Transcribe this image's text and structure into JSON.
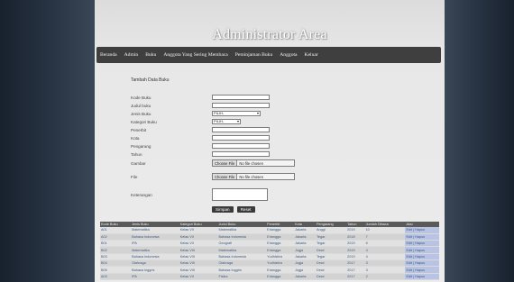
{
  "header": {
    "title": "Administrator Area"
  },
  "nav": [
    "Beranda",
    "Admin",
    "Buku",
    "Anggota Yang Sering Membaca",
    "Peminjaman Buku",
    "Anggota",
    "Keluar"
  ],
  "form": {
    "title": "Tambah Data Buku",
    "fields": {
      "kode": {
        "label": "Kode Buku"
      },
      "judul": {
        "label": "Judul buku"
      },
      "jenis": {
        "label": "Jenis Buku",
        "value": "PILIH-"
      },
      "kategori": {
        "label": "Kategori Buku",
        "value": "PILIH-"
      },
      "penerbit": {
        "label": "Penerbit"
      },
      "kota": {
        "label": "Kota"
      },
      "pengarang": {
        "label": "Pengarang"
      },
      "tahun": {
        "label": "Tahun"
      },
      "gambar": {
        "label": "Gambar",
        "button": "Choose File",
        "status": "No file chosen"
      },
      "file": {
        "label": "File",
        "button": "Choose File",
        "status": "No file chosen"
      },
      "keterangan": {
        "label": "Keterangan"
      }
    },
    "save_label": "Simpan",
    "reset_label": "Reset"
  },
  "table": {
    "headers": [
      "Kode Buku",
      "Jenis Buku",
      "Kategori Buku",
      "Judul Buku",
      "Penerbit",
      "Kota",
      "Pengarang",
      "Tahun",
      "Jumlah Dibaca",
      "Aksi"
    ],
    "rows": [
      [
        "A01",
        "Matematika",
        "Kelas VII",
        "Matematika",
        "Erlangga",
        "Jakarta",
        "Anggi",
        "2019",
        "10",
        "Edit | Hapus"
      ],
      [
        "A02",
        "Bahasa Indonesia",
        "Kelas VII",
        "Bahasa Indonesia",
        "Erlangga",
        "Jakarta",
        "Tegar",
        "2018",
        "7",
        "Edit | Hapus"
      ],
      [
        "B01",
        "IPA",
        "Kelas VII",
        "Geografi",
        "Erlangga",
        "Jakarta",
        "Tegar",
        "2019",
        "6",
        "Edit | Hapus"
      ],
      [
        "B02",
        "Matematika",
        "Kelas VIII",
        "Matematika",
        "Erlangga",
        "Jogja",
        "Dewi",
        "2019",
        "4",
        "Edit | Hapus"
      ],
      [
        "B03",
        "Bahasa Indonesia",
        "Kelas VIII",
        "Bahasa Indonesia",
        "Yudhistira",
        "Jakarta",
        "Tegar",
        "2019",
        "4",
        "Edit | Hapus"
      ],
      [
        "B04",
        "Olahraga",
        "Kelas VIII",
        "Olahraga",
        "Yudhistira",
        "Jogja",
        "Dewi",
        "2017",
        "3",
        "Edit | Hapus"
      ],
      [
        "B05",
        "Bahasa Inggris",
        "Kelas VIII",
        "Bahasa Inggris",
        "Erlangga",
        "Jogja",
        "Dewi",
        "2017",
        "3",
        "Edit | Hapus"
      ],
      [
        "A03",
        "IPA",
        "Kelas VII",
        "Fisika",
        "Erlangga",
        "Jakarta",
        "Dewi",
        "2017",
        "2",
        "Edit | Hapus"
      ]
    ]
  }
}
